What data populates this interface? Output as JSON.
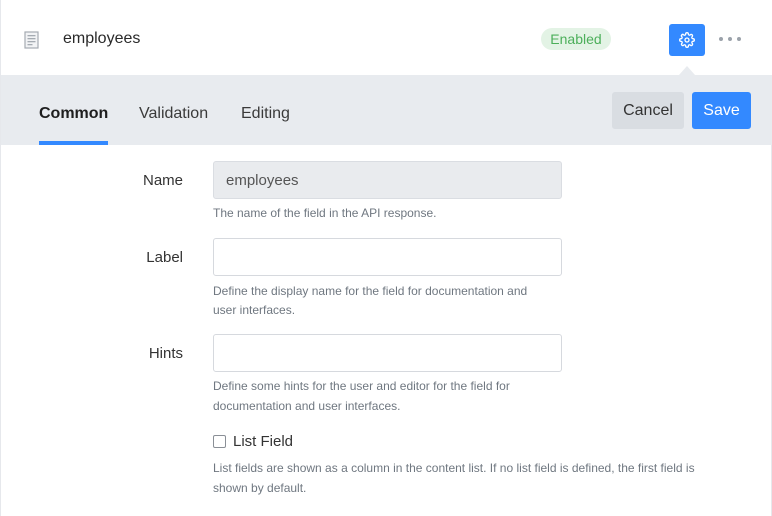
{
  "header": {
    "field_name": "employees",
    "status_badge": "Enabled",
    "icons": {
      "field_type": "document-icon",
      "settings": "gear-icon",
      "more": "more-dots-icon"
    }
  },
  "tabs": [
    {
      "label": "Common",
      "active": true
    },
    {
      "label": "Validation",
      "active": false
    },
    {
      "label": "Editing",
      "active": false
    }
  ],
  "actions": {
    "cancel_label": "Cancel",
    "save_label": "Save"
  },
  "form": {
    "name": {
      "label": "Name",
      "value": "employees",
      "hint": "The name of the field in the API response."
    },
    "label": {
      "label": "Label",
      "value": "",
      "hint_line1": "Define the display name for the field for documentation and",
      "hint_line2": "user interfaces."
    },
    "hints": {
      "label": "Hints",
      "value": "",
      "hint_line1": "Define some hints for the user and editor for the field for",
      "hint_line2": "documentation and user interfaces."
    },
    "list_field": {
      "label": "List Field",
      "checked": false,
      "hint_line1": "List fields are shown as a column in the content list. If no list field is defined, the first field is",
      "hint_line2": "shown by default."
    }
  },
  "colors": {
    "accent": "#3389ff",
    "badge_bg": "#e3f3e5",
    "badge_text": "#4caf5a",
    "tabbar_bg": "#e8ebef"
  }
}
